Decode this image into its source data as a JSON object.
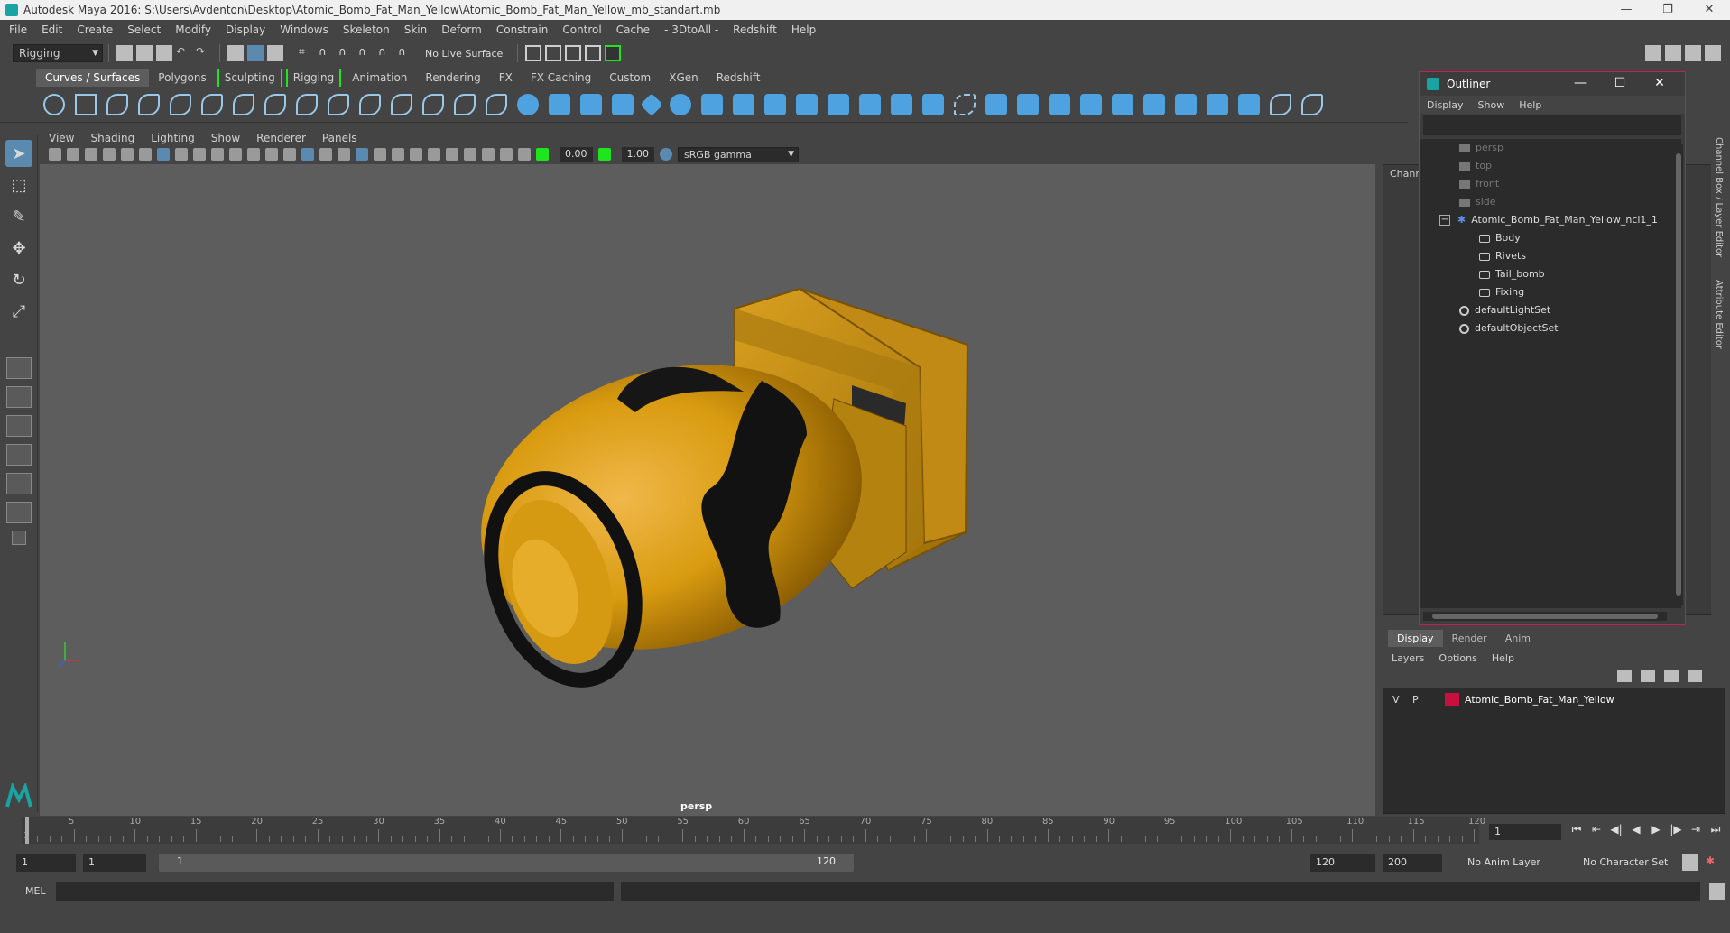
{
  "window": {
    "title": "Autodesk Maya 2016: S:\\Users\\Avdenton\\Desktop\\Atomic_Bomb_Fat_Man_Yellow\\Atomic_Bomb_Fat_Man_Yellow_mb_standart.mb",
    "minimize": "—",
    "maximize": "❐",
    "close": "✕"
  },
  "menubar": [
    "File",
    "Edit",
    "Create",
    "Select",
    "Modify",
    "Display",
    "Windows",
    "Skeleton",
    "Skin",
    "Deform",
    "Constrain",
    "Control",
    "Cache",
    "- 3DtoAll -",
    "Redshift",
    "Help"
  ],
  "statusline": {
    "mode": "Rigging",
    "live_surface": "No Live Surface"
  },
  "shelf_tabs": [
    {
      "label": "Curves / Surfaces",
      "active": true
    },
    {
      "label": "Polygons"
    },
    {
      "label": "Sculpting",
      "bracket": true
    },
    {
      "label": "Rigging",
      "bracket": true
    },
    {
      "label": "Animation"
    },
    {
      "label": "Rendering"
    },
    {
      "label": "FX"
    },
    {
      "label": "FX Caching"
    },
    {
      "label": "Custom"
    },
    {
      "label": "XGen"
    },
    {
      "label": "Redshift"
    }
  ],
  "viewport": {
    "menu": [
      "View",
      "Shading",
      "Lighting",
      "Show",
      "Renderer",
      "Panels"
    ],
    "exposure": "0.00",
    "gamma": "1.00",
    "color_space": "sRGB gamma",
    "camera": "persp"
  },
  "channel_box": {
    "label": "Chann",
    "side_tabs": [
      "Channel Box / Layer Editor",
      "Attribute Editor"
    ]
  },
  "outliner": {
    "title": "Outliner",
    "menu": [
      "Display",
      "Show",
      "Help"
    ],
    "items": [
      {
        "label": "persp",
        "type": "camera",
        "dim": true
      },
      {
        "label": "top",
        "type": "camera",
        "dim": true
      },
      {
        "label": "front",
        "type": "camera",
        "dim": true
      },
      {
        "label": "side",
        "type": "camera",
        "dim": true
      },
      {
        "label": "Atomic_Bomb_Fat_Man_Yellow_ncl1_1",
        "type": "group"
      },
      {
        "label": "Body",
        "type": "mesh",
        "child": true
      },
      {
        "label": "Rivets",
        "type": "mesh",
        "child": true
      },
      {
        "label": "Tail_bomb",
        "type": "mesh",
        "child": true
      },
      {
        "label": "Fixing",
        "type": "mesh",
        "child": true
      },
      {
        "label": "defaultLightSet",
        "type": "set"
      },
      {
        "label": "defaultObjectSet",
        "type": "set"
      }
    ]
  },
  "layer_editor": {
    "tabs": [
      "Display",
      "Render",
      "Anim"
    ],
    "menu": [
      "Layers",
      "Options",
      "Help"
    ],
    "layers": [
      {
        "v": "V",
        "p": "P",
        "name": "Atomic_Bomb_Fat_Man_Yellow",
        "color": "#c8103e"
      }
    ]
  },
  "timeline": {
    "ticks": [
      "5",
      "10",
      "15",
      "20",
      "25",
      "30",
      "35",
      "40",
      "45",
      "50",
      "55",
      "60",
      "65",
      "70",
      "75",
      "80",
      "85",
      "90",
      "95",
      "100",
      "105",
      "110",
      "115",
      "120"
    ],
    "first_tick": "1",
    "current_frame": "1",
    "playback_buttons": [
      "⏮",
      "⇤",
      "◀|",
      "◀",
      "▶",
      "|▶",
      "⇥",
      "⏭"
    ]
  },
  "range": {
    "start": "1",
    "start2": "1",
    "bar_start": "1",
    "bar_end": "120",
    "end": "120",
    "end2": "200",
    "anim_layer": "No Anim Layer",
    "char_set": "No Character Set"
  },
  "cmdline": {
    "lang": "MEL"
  }
}
